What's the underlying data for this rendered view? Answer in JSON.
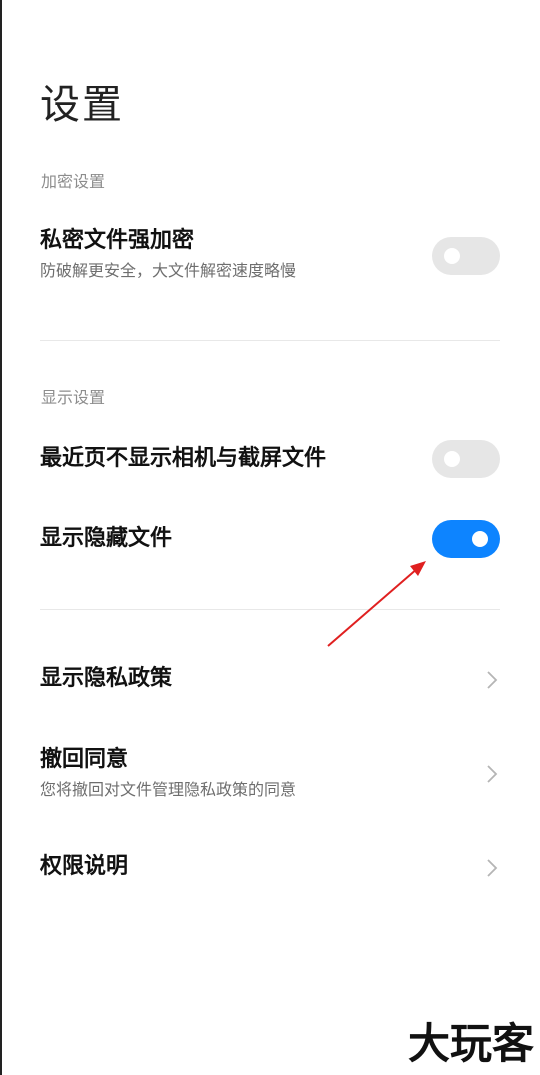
{
  "header": {
    "title": "设置"
  },
  "sections": {
    "encryption": {
      "label": "加密设置",
      "private_file": {
        "title": "私密文件强加密",
        "subtitle": "防破解更安全，大文件解密速度略慢",
        "enabled": false
      }
    },
    "display": {
      "label": "显示设置",
      "hide_camera_screenshots": {
        "title": "最近页不显示相机与截屏文件",
        "enabled": false
      },
      "show_hidden_files": {
        "title": "显示隐藏文件",
        "enabled": true
      }
    }
  },
  "links": {
    "privacy_policy": {
      "title": "显示隐私政策"
    },
    "revoke_consent": {
      "title": "撤回同意",
      "subtitle": "您将撤回对文件管理隐私政策的同意"
    },
    "permissions": {
      "title": "权限说明"
    }
  },
  "watermark": {
    "text": "大玩客"
  },
  "colors": {
    "accent": "#0d84ff",
    "toggle_off": "#e6e6e6",
    "annotation_arrow": "#e02020"
  }
}
